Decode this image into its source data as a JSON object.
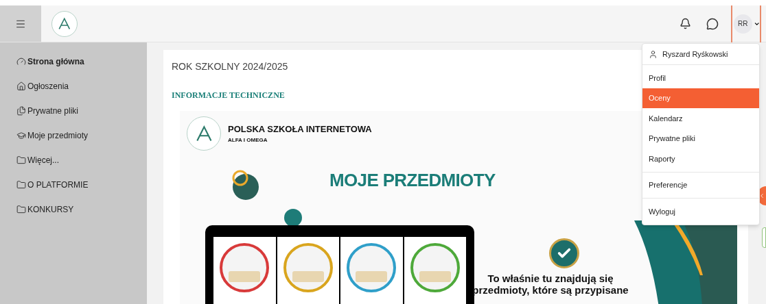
{
  "header": {
    "avatar_initials": "RR"
  },
  "sidebar": {
    "items": [
      {
        "label": "Strona główna",
        "kind": "dashboard",
        "selected": true
      },
      {
        "label": "Ogłoszenia",
        "kind": "home",
        "selected": false
      },
      {
        "label": "Prywatne pliki",
        "kind": "files",
        "selected": false
      },
      {
        "label": "Moje przedmioty",
        "kind": "subjects",
        "selected": false
      },
      {
        "label": "Więcej...",
        "kind": "folder",
        "selected": false
      },
      {
        "label": "O PLATFORMIE",
        "kind": "folder",
        "selected": false
      },
      {
        "label": "KONKURSY",
        "kind": "folder",
        "selected": false
      }
    ]
  },
  "content": {
    "year": "ROK SZKOLNY 2024/2025",
    "section": "INFORMACJE TECHNICZNE",
    "poster": {
      "school": "POLSKA SZKOŁA INTERNETOWA",
      "school_sub": "ALFA I OMEGA",
      "title": "MOJE PRZEDMIOTY",
      "text_lines": [
        "To właśnie tu znajdują się",
        "przedmioty, które są przypisane"
      ]
    }
  },
  "user_menu": {
    "sections": [
      [
        {
          "label": "Ryszard Ryśkowski",
          "kind": "user",
          "selected": false
        }
      ],
      [
        {
          "label": "Profil",
          "kind": "item",
          "selected": false
        },
        {
          "label": "Oceny",
          "kind": "item",
          "selected": true
        },
        {
          "label": "Kalendarz",
          "kind": "item",
          "selected": false
        },
        {
          "label": "Prywatne pliki",
          "kind": "item",
          "selected": false
        },
        {
          "label": "Raporty",
          "kind": "item",
          "selected": false
        }
      ],
      [
        {
          "label": "Preferencje",
          "kind": "item",
          "selected": false
        }
      ],
      [
        {
          "label": "Wyloguj",
          "kind": "item",
          "selected": false
        }
      ]
    ]
  }
}
